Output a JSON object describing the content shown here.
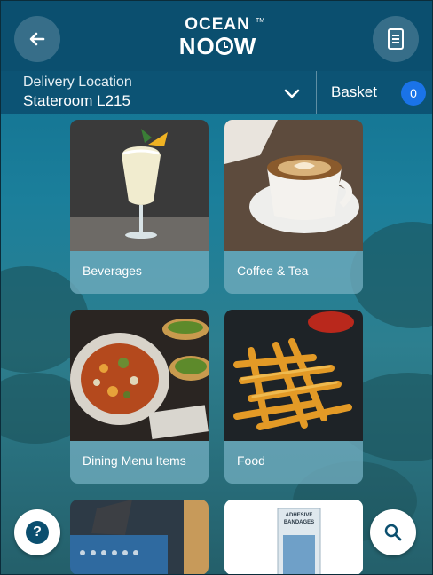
{
  "header": {
    "logo_top": "OCEAN",
    "logo_bottom_left": "N",
    "logo_bottom_right": "W",
    "logo_tm": "TM"
  },
  "delivery": {
    "label": "Delivery Location",
    "value": "Stateroom L215"
  },
  "basket": {
    "label": "Basket",
    "count": "0"
  },
  "categories": [
    {
      "label": "Beverages"
    },
    {
      "label": "Coffee & Tea"
    },
    {
      "label": "Dining Menu Items"
    },
    {
      "label": "Food"
    }
  ],
  "partial_tile": {
    "package_text_1": "ADHESIVE",
    "package_text_2": "BANDAGES"
  },
  "icons": {
    "back": "back-arrow-icon",
    "menu": "document-icon",
    "dropdown": "chevron-down-icon",
    "help": "help-icon",
    "search": "search-icon"
  },
  "colors": {
    "header": "#0b4f6f",
    "badge": "#1a73e8",
    "tile_label": "#71acbe"
  }
}
